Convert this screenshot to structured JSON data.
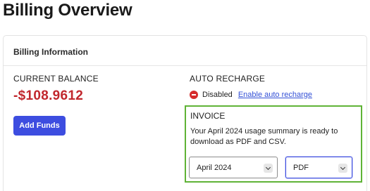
{
  "page": {
    "title": "Billing Overview"
  },
  "card": {
    "title": "Billing Information"
  },
  "balance": {
    "label": "CURRENT BALANCE",
    "value": "-$108.9612",
    "add_funds_label": "Add Funds"
  },
  "auto_recharge": {
    "label": "AUTO RECHARGE",
    "status": "Disabled",
    "status_icon": "disabled-icon",
    "link": "Enable auto recharge"
  },
  "invoice": {
    "title": "INVOICE",
    "description": "Your April 2024 usage summary is ready to download as PDF and CSV.",
    "month_selected": "April 2024",
    "format_selected": "PDF"
  },
  "colors": {
    "accent": "#3d4de0",
    "negative_balance": "#c1272d",
    "highlight_border": "#5fb336",
    "link": "#3350d6"
  }
}
